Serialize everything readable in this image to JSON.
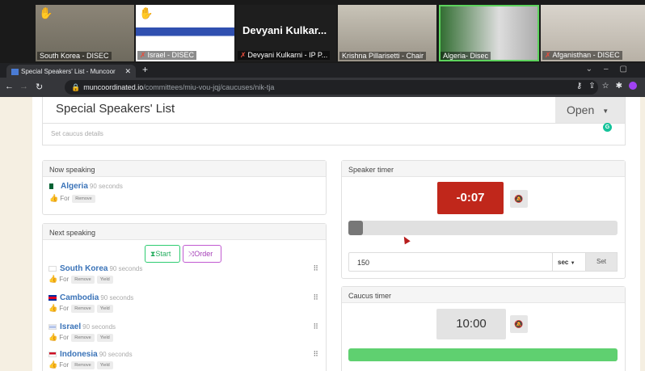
{
  "zoom": {
    "participants": [
      {
        "name": "South Korea - DISEC",
        "muted": false,
        "hand": true
      },
      {
        "name": "Israel - DISEC",
        "muted": true,
        "hand": true
      },
      {
        "name": "Devyani Kulkarni - IP P...",
        "muted": true,
        "hand": false
      },
      {
        "name": "Krishna Pillarisetti - Chair",
        "muted": false,
        "hand": false
      },
      {
        "name": "Algeria- Disec",
        "muted": false,
        "hand": false,
        "active": true
      },
      {
        "name": "Afganisthan - DISEC",
        "muted": true,
        "hand": false
      }
    ],
    "big_name": "Devyani  Kulkar..."
  },
  "browser": {
    "tab_title": "Special Speakers' List - Muncoor",
    "url_host": "muncoordinated.io",
    "url_path": "/committees/miu-vou-jqj/caucuses/nik-tja"
  },
  "caucus": {
    "title": "Special Speakers' List",
    "status": "Open",
    "details_placeholder": "Set caucus details"
  },
  "now_speaking": {
    "header": "Now speaking",
    "country": "Algeria",
    "duration": "90 seconds",
    "stance": "For",
    "remove_label": "Remove"
  },
  "next_speaking": {
    "header": "Next speaking",
    "start_label": "Start",
    "order_label": "Order",
    "speakers": [
      {
        "country": "South Korea",
        "duration": "90 seconds",
        "stance": "For",
        "flag": "#c60c30"
      },
      {
        "country": "Cambodia",
        "duration": "90 seconds",
        "stance": "For",
        "flag": "#032ea1"
      },
      {
        "country": "Israel",
        "duration": "90 seconds",
        "stance": "For",
        "flag": "#0038b8"
      },
      {
        "country": "Indonesia",
        "duration": "90 seconds",
        "stance": "For",
        "flag": "#ce1126"
      }
    ],
    "remove_label": "Remove",
    "yield_label": "Yield"
  },
  "speaker_timer": {
    "header": "Speaker timer",
    "value": "-0:07",
    "progress": 0.05,
    "duration_input": "150",
    "unit": "sec",
    "set_label": "Set"
  },
  "caucus_timer": {
    "header": "Caucus timer",
    "value": "10:00",
    "progress": 1.0
  }
}
